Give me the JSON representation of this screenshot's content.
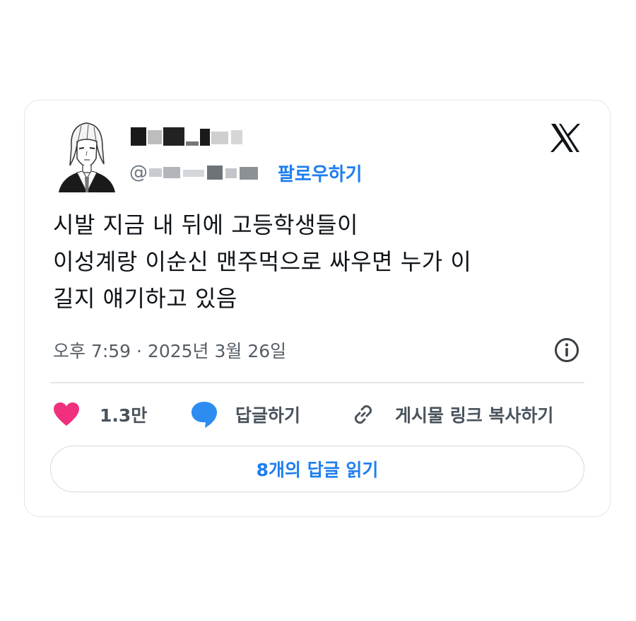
{
  "tweet": {
    "handle_prefix": "@",
    "follow_label": "팔로우하기",
    "text_lines": [
      "시발 지금 내 뒤에 고등학생들이",
      "이성계랑 이순신 맨주먹으로 싸우면 누가 이",
      "길지 얘기하고 있음"
    ],
    "timestamp": "오후 7:59 · 2025년 3월 26일"
  },
  "actions": {
    "like_count": "1.3만",
    "reply_label": "답글하기",
    "copy_link_label": "게시물 링크 복사하기"
  },
  "read_replies_label": "8개의 답글 읽기",
  "icons": {
    "logo": "x-logo-icon",
    "info": "info-icon",
    "like": "heart-icon",
    "reply": "speech-bubble-icon",
    "link": "link-icon"
  },
  "colors": {
    "accent": "#1d7ef0",
    "heart": "#f0307d",
    "reply_bubble": "#2d8cf0",
    "text": "#0f1419",
    "muted": "#555d66"
  }
}
